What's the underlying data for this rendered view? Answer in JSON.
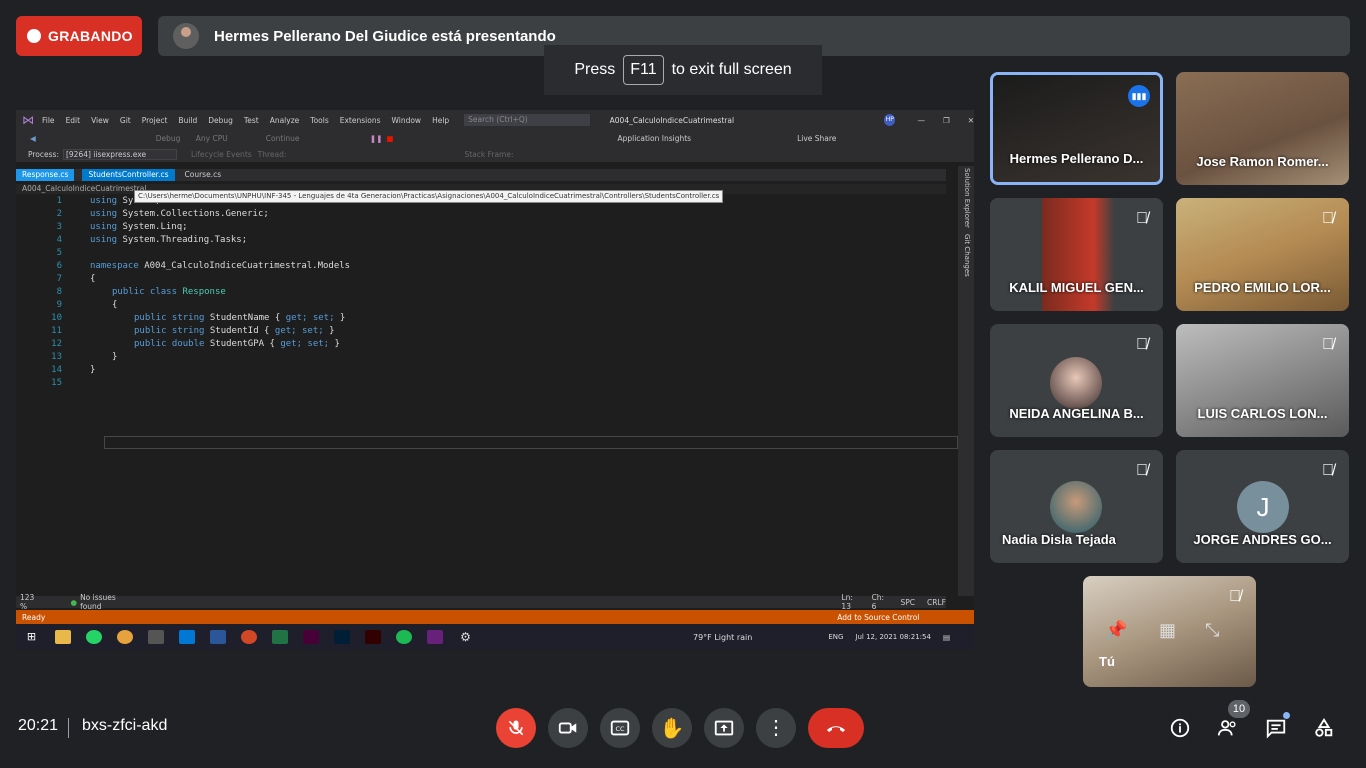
{
  "recording": {
    "label": "GRABANDO"
  },
  "presenter_banner": {
    "text": "Hermes Pellerano Del Giudice está presentando"
  },
  "fullscreen_hint": {
    "press": "Press",
    "key": "F11",
    "rest": "to exit full screen"
  },
  "screen": {
    "menu": [
      "File",
      "Edit",
      "View",
      "Git",
      "Project",
      "Build",
      "Debug",
      "Test",
      "Analyze",
      "Tools",
      "Extensions",
      "Window",
      "Help"
    ],
    "search_placeholder": "Search (Ctrl+Q)",
    "solution_name": "A004_CalculoIndiceCuatrimestral",
    "user_badge": "HP",
    "toolbar": {
      "config": "Debug",
      "platform": "Any CPU",
      "run": "Continue",
      "insights": "Application Insights",
      "live_share": "Live Share"
    },
    "process_label": "Process:",
    "process_value": "[9264] iisexpress.exe",
    "lifecycle": "Lifecycle Events",
    "thread": "Thread:",
    "stack_frame": "Stack Frame:",
    "tabs": [
      "Response.cs",
      "StudentsController.cs",
      "Course.cs"
    ],
    "path_left": "A004_CalculoIndiceCuatrimestral",
    "tooltip": "C:\\Users\\herme\\Documents\\UNPHU\\INF-345 - Lenguajes de 4ta Generacion\\Practicas\\Asignaciones\\A004_CalculoIndiceCuatrimestral\\Controllers\\StudentsController.cs",
    "line_numbers": [
      "1",
      "2",
      "3",
      "4",
      "5",
      "6",
      "7",
      "8",
      "9",
      "10",
      "11",
      "12",
      "13",
      "14",
      "15"
    ],
    "code": {
      "l1_kw": "using",
      "l1": " System;",
      "l2_kw": "using",
      "l2": " System.Collections.Generic;",
      "l3_kw": "using",
      "l3": " System.Linq;",
      "l4_kw": "using",
      "l4": " System.Threading.Tasks;",
      "l6_kw": "namespace",
      "l6": " A004_CalculoIndiceCuatrimestral.Models",
      "l7": "{",
      "l8_kw": "public class",
      "l8_ty": " Response",
      "l9": "{",
      "l10_kw": "public string",
      "l10": " StudentName { ",
      "l10_acc": "get; set;",
      "l10_end": " }",
      "l11_kw": "public string",
      "l11": " StudentId { ",
      "l11_acc": "get; set;",
      "l11_end": " }",
      "l12_kw": "public double",
      "l12": " StudentGPA { ",
      "l12_acc": "get; set;",
      "l12_end": " }",
      "l13": "}",
      "l14": "}"
    },
    "zoom": "123 %",
    "issues": "No issues found",
    "ln": "Ln: 13",
    "ch": "Ch: 6",
    "spc": "SPC",
    "crlf": "CRLF",
    "status": "Ready",
    "source_control": "Add to Source Control",
    "right_pane": [
      "Solution Explorer",
      "Git Changes"
    ],
    "weather": "79°F  Light rain",
    "lang": "ENG",
    "datetime": "Jul 12, 2021 08:21:54"
  },
  "participants": [
    {
      "name": "Hermes Pellerano D...",
      "speaking": true
    },
    {
      "name": "Jose Ramon Romer...",
      "muted": false
    },
    {
      "name": "KALIL MIGUEL GEN...",
      "muted": true
    },
    {
      "name": "PEDRO EMILIO LOR...",
      "muted": true
    },
    {
      "name": "NEIDA ANGELINA B...",
      "muted": true
    },
    {
      "name": "LUIS CARLOS LON...",
      "muted": true
    },
    {
      "name": "Nadia Disla Tejada",
      "muted": true
    },
    {
      "name": "JORGE ANDRES GO...",
      "muted": true,
      "initial": "J",
      "color": "#78909c"
    }
  ],
  "self_tile": {
    "name": "Tú"
  },
  "meeting": {
    "time": "20:21",
    "code": "bxs-zfci-akd",
    "participant_count": "10"
  },
  "colors": {
    "accent_red": "#d93025",
    "tile_bg": "#3c4043",
    "active_border": "#8ab4f8",
    "vs_blue": "#007acc"
  }
}
